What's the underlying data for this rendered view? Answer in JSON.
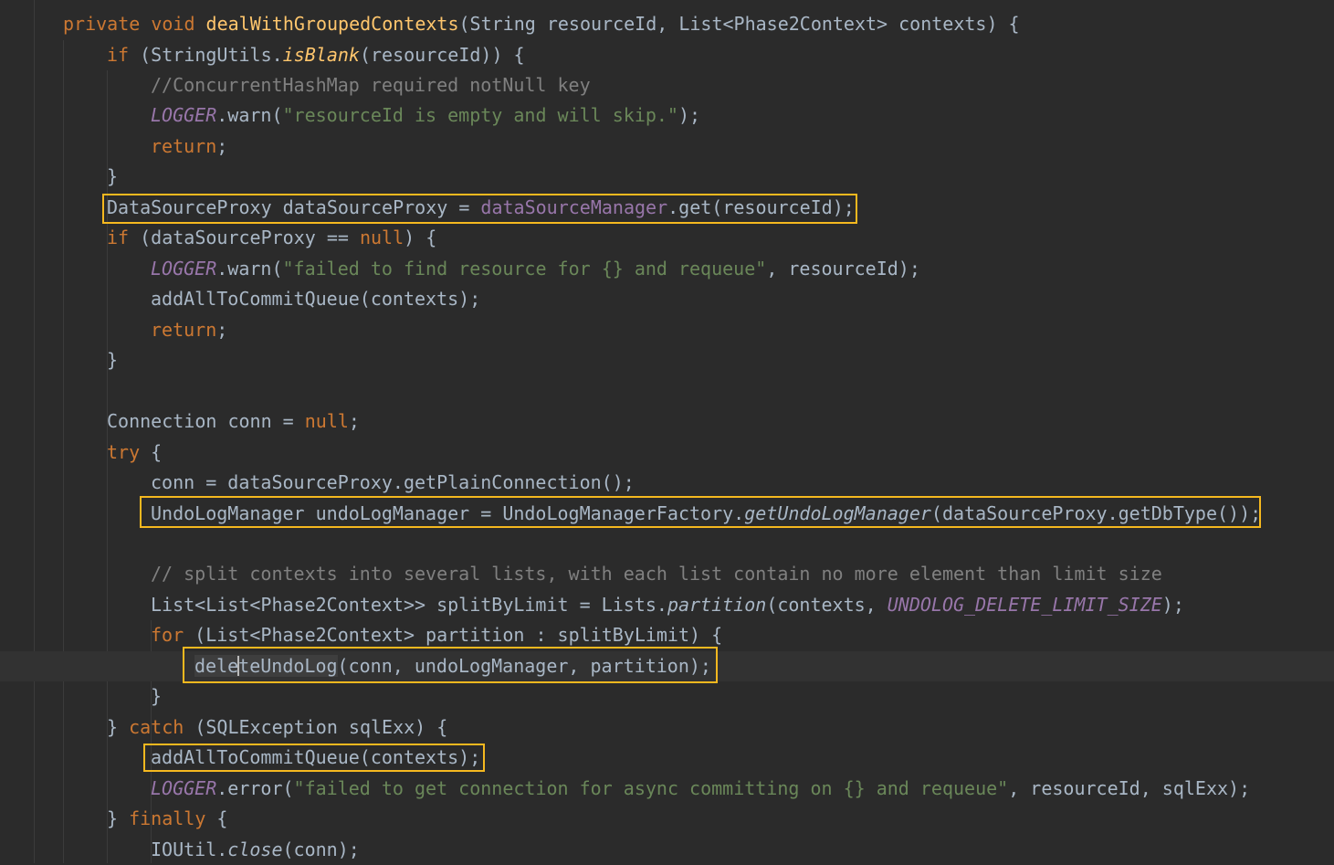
{
  "editor": {
    "lines": [
      [
        [
          "kw",
          "private "
        ],
        [
          "kw",
          "void "
        ],
        [
          "fn",
          "dealWithGroupedContexts"
        ],
        [
          "plain",
          "(String resourceId, List<Phase2Context> contexts) {"
        ]
      ],
      [
        [
          "kw",
          "if "
        ],
        [
          "plain",
          "(StringUtils."
        ],
        [
          "fnI",
          "isBlank"
        ],
        [
          "plain",
          "(resourceId)) {"
        ]
      ],
      [
        [
          "cmt",
          "//ConcurrentHashMap required notNull key"
        ]
      ],
      [
        [
          "fldI",
          "LOGGER"
        ],
        [
          "plain",
          ".warn("
        ],
        [
          "str",
          "\"resourceId is empty and will skip.\""
        ],
        [
          "plain",
          ");"
        ]
      ],
      [
        [
          "kw",
          "return"
        ],
        [
          "plain",
          ";"
        ]
      ],
      [
        [
          "plain",
          "}"
        ]
      ],
      [
        [
          "plain",
          "DataSourceProxy dataSourceProxy = "
        ],
        [
          "fld",
          "dataSourceManager"
        ],
        [
          "plain",
          ".get(resourceId);"
        ]
      ],
      [
        [
          "kw",
          "if "
        ],
        [
          "plain",
          "(dataSourceProxy == "
        ],
        [
          "kw",
          "null"
        ],
        [
          "plain",
          ") {"
        ]
      ],
      [
        [
          "fldI",
          "LOGGER"
        ],
        [
          "plain",
          ".warn("
        ],
        [
          "str",
          "\"failed to find resource for {} and requeue\""
        ],
        [
          "plain",
          ", resourceId);"
        ]
      ],
      [
        [
          "plain",
          "addAllToCommitQueue(contexts);"
        ]
      ],
      [
        [
          "kw",
          "return"
        ],
        [
          "plain",
          ";"
        ]
      ],
      [
        [
          "plain",
          "}"
        ]
      ],
      [],
      [
        [
          "plain",
          "Connection conn = "
        ],
        [
          "kw",
          "null"
        ],
        [
          "plain",
          ";"
        ]
      ],
      [
        [
          "kw",
          "try "
        ],
        [
          "plain",
          "{"
        ]
      ],
      [
        [
          "plain",
          "conn = dataSourceProxy.getPlainConnection();"
        ]
      ],
      [
        [
          "plain",
          "UndoLogManager undoLogManager = UndoLogManagerFactory."
        ],
        [
          "plainI",
          "getUndoLogManager"
        ],
        [
          "plain",
          "(dataSourceProxy.getDbType());"
        ]
      ],
      [],
      [
        [
          "cmt",
          "// split contexts into several lists, with each list contain no more element than limit size"
        ]
      ],
      [
        [
          "plain",
          "List<List<Phase2Context>> splitByLimit = Lists."
        ],
        [
          "plainI",
          "partition"
        ],
        [
          "plain",
          "(contexts, "
        ],
        [
          "fldI",
          "UNDOLOG_DELETE_LIMIT_SIZE"
        ],
        [
          "plain",
          ");"
        ]
      ],
      [
        [
          "kw",
          "for "
        ],
        [
          "plain",
          "(List<Phase2Context> partition : splitByLimit) {"
        ]
      ],
      [
        [
          "sel",
          "deleteUndoLog"
        ],
        [
          "plain",
          "(conn, undoLogManager, partition);"
        ]
      ],
      [
        [
          "plain",
          "}"
        ]
      ],
      [
        [
          "plain",
          "} "
        ],
        [
          "kw",
          "catch "
        ],
        [
          "plain",
          "(SQLException sqlExx) {"
        ]
      ],
      [
        [
          "plain",
          "addAllToCommitQueue(contexts);"
        ]
      ],
      [
        [
          "fldI",
          "LOGGER"
        ],
        [
          "plain",
          ".error("
        ],
        [
          "str",
          "\"failed to get connection for async committing on {} and requeue\""
        ],
        [
          "plain",
          ", resourceId, sqlExx);"
        ]
      ],
      [
        [
          "plain",
          "} "
        ],
        [
          "kw",
          "finally "
        ],
        [
          "plain",
          "{"
        ]
      ],
      [
        [
          "plain",
          "IOUtil."
        ],
        [
          "plainI",
          "close"
        ],
        [
          "plain",
          "(conn);"
        ]
      ]
    ],
    "indents": [
      1,
      2,
      3,
      3,
      3,
      2,
      2,
      2,
      3,
      3,
      3,
      2,
      0,
      2,
      2,
      3,
      3,
      0,
      3,
      3,
      3,
      4,
      3,
      2,
      3,
      3,
      2,
      3
    ]
  }
}
